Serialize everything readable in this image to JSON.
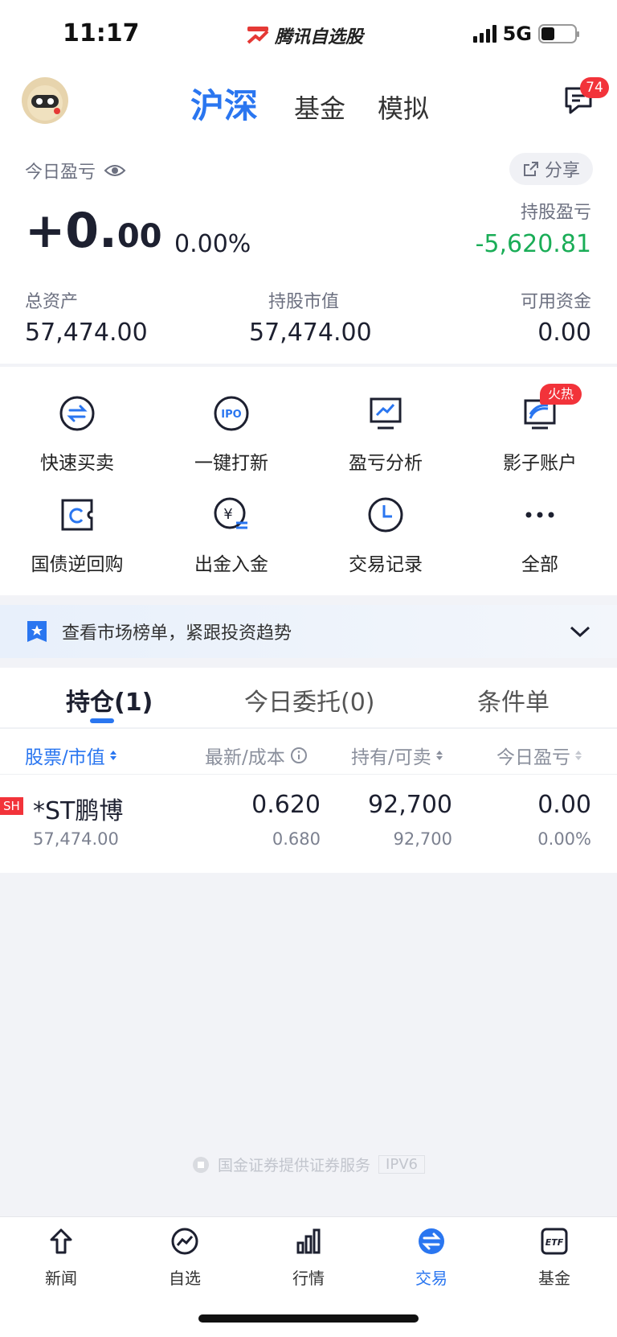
{
  "status": {
    "time": "11:17",
    "app_name": "腾讯自选股",
    "network": "5G"
  },
  "header": {
    "tabs": [
      "沪深",
      "基金",
      "模拟"
    ],
    "message_badge": "74"
  },
  "summary": {
    "today_label": "今日盈亏",
    "share_label": "分享",
    "pnl_int": "+0.",
    "pnl_dec": "00",
    "pnl_pct": "0.00%",
    "hold_pnl_label": "持股盈亏",
    "hold_pnl_value": "-5,620.81",
    "total_assets_label": "总资产",
    "total_assets_value": "57,474.00",
    "market_value_label": "持股市值",
    "market_value_value": "57,474.00",
    "available_label": "可用资金",
    "available_value": "0.00"
  },
  "quick": [
    {
      "label": "快速买卖",
      "icon": "swap-icon"
    },
    {
      "label": "一键打新",
      "icon": "ipo-icon"
    },
    {
      "label": "盈亏分析",
      "icon": "analysis-icon"
    },
    {
      "label": "影子账户",
      "icon": "shadow-account-icon"
    },
    {
      "label": "国债逆回购",
      "icon": "repo-icon"
    },
    {
      "label": "出金入金",
      "icon": "transfer-icon"
    },
    {
      "label": "交易记录",
      "icon": "clock-icon"
    },
    {
      "label": "全部",
      "icon": "more-icon"
    }
  ],
  "hot_badge": "火热",
  "banner": {
    "text": "查看市场榜单，紧跟投资趋势"
  },
  "holdings_tabs": [
    "持仓(1)",
    "今日委托(0)",
    "条件单"
  ],
  "columns": [
    "股票/市值",
    "最新/成本",
    "持有/可卖",
    "今日盈亏"
  ],
  "rows": [
    {
      "market": "SH",
      "name": "*ST鹏博",
      "market_value": "57,474.00",
      "latest": "0.620",
      "cost": "0.680",
      "hold": "92,700",
      "sellable": "92,700",
      "today_pnl": "0.00",
      "today_pct": "0.00%"
    }
  ],
  "footer": {
    "note": "国金证券提供证券服务",
    "tag": "IPV6"
  },
  "tabbar": [
    {
      "label": "新闻",
      "icon": "news-icon"
    },
    {
      "label": "自选",
      "icon": "watchlist-icon"
    },
    {
      "label": "行情",
      "icon": "market-icon"
    },
    {
      "label": "交易",
      "icon": "trade-icon"
    },
    {
      "label": "基金",
      "icon": "etf-icon"
    }
  ],
  "colors": {
    "accent": "#2a76f0",
    "red": "#f2333a",
    "green": "#1aad57"
  }
}
